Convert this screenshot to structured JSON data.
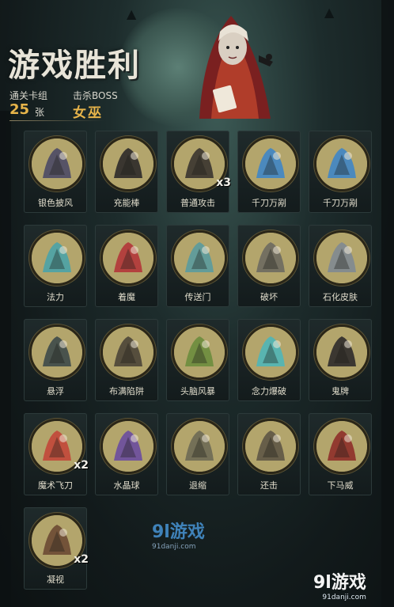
{
  "header": {
    "title": "游戏胜利",
    "deck_label": "通关卡组",
    "deck_count": "25",
    "deck_unit": "张",
    "boss_label": "击杀BOSS",
    "boss_name": "女巫"
  },
  "cards": [
    {
      "name": "银色披风",
      "icon": "cloak-icon",
      "color": "#4b4a66",
      "mult": ""
    },
    {
      "name": "充能棒",
      "icon": "wand-icon",
      "color": "#2c2a2a",
      "mult": ""
    },
    {
      "name": "普通攻击",
      "icon": "strike-icon",
      "color": "#3a3530",
      "mult": "x3"
    },
    {
      "name": "千刀万剐",
      "icon": "blades-icon",
      "color": "#3f86c6",
      "mult": ""
    },
    {
      "name": "千刀万剐",
      "icon": "blades-icon",
      "color": "#3f86c6",
      "mult": ""
    },
    {
      "name": "法力",
      "icon": "mana-icon",
      "color": "#4aa3a9",
      "mult": ""
    },
    {
      "name": "着魔",
      "icon": "possessed-icon",
      "color": "#b2363a",
      "mult": ""
    },
    {
      "name": "传送门",
      "icon": "portal-icon",
      "color": "#5a9b9e",
      "mult": ""
    },
    {
      "name": "破坏",
      "icon": "hammer-icon",
      "color": "#6d6a60",
      "mult": ""
    },
    {
      "name": "石化皮肤",
      "icon": "stone-skin-icon",
      "color": "#7f8a92",
      "mult": ""
    },
    {
      "name": "悬浮",
      "icon": "levitate-icon",
      "color": "#3d4a4a",
      "mult": ""
    },
    {
      "name": "布满陷阱",
      "icon": "traps-icon",
      "color": "#4b4538",
      "mult": ""
    },
    {
      "name": "头脑风暴",
      "icon": "brainstorm-icon",
      "color": "#6b8d3e",
      "mult": ""
    },
    {
      "name": "念力爆破",
      "icon": "psychic-blast-icon",
      "color": "#4fb6b8",
      "mult": ""
    },
    {
      "name": "鬼牌",
      "icon": "ghost-card-icon",
      "color": "#2e2b2b",
      "mult": ""
    },
    {
      "name": "魔术飞刀",
      "icon": "magic-knife-icon",
      "color": "#c2473a",
      "mult": "x2"
    },
    {
      "name": "水晶球",
      "icon": "crystal-ball-icon",
      "color": "#6a4ca0",
      "mult": ""
    },
    {
      "name": "退缩",
      "icon": "retreat-icon",
      "color": "#6d6a55",
      "mult": ""
    },
    {
      "name": "还击",
      "icon": "counter-icon",
      "color": "#5e5646",
      "mult": ""
    },
    {
      "name": "下马威",
      "icon": "intimidate-icon",
      "color": "#8e2f2a",
      "mult": ""
    },
    {
      "name": "凝视",
      "icon": "gaze-icon",
      "color": "#6b4a34",
      "mult": "x2"
    }
  ],
  "watermark": {
    "center_brand": "9l游戏",
    "center_url": "91danji.com",
    "corner_brand": "9l游戏",
    "corner_url": "91danji.com"
  }
}
